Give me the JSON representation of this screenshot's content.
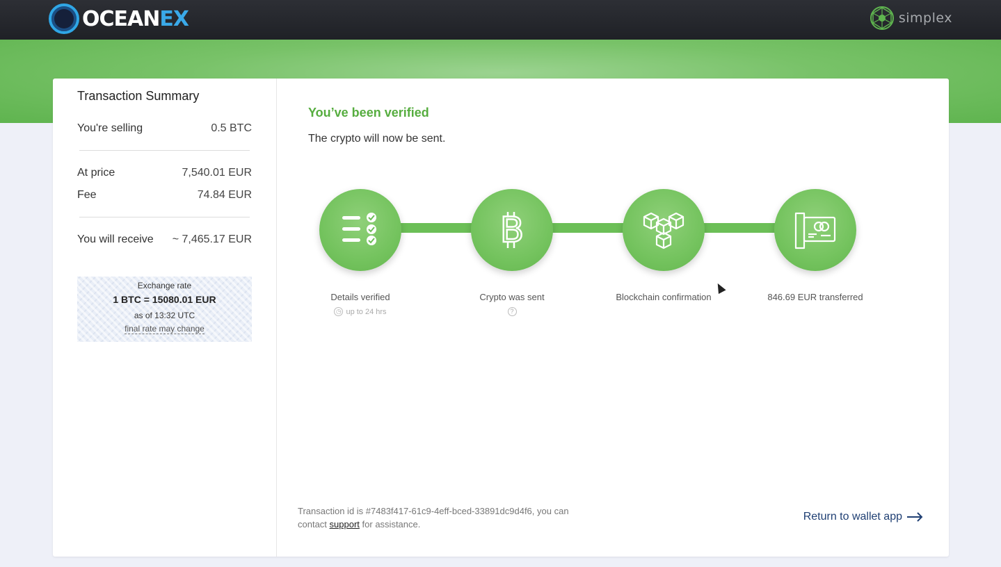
{
  "header": {
    "logo_main": "OCEAN",
    "logo_accent": "EX",
    "partner_name": "simplex",
    "logo_icon": "oceanex-ring-icon",
    "partner_icon": "simplex-network-icon"
  },
  "summary": {
    "title": "Transaction Summary",
    "selling_label": "You're selling",
    "selling_value": "0.5 BTC",
    "price_label": "At price",
    "price_value": "7,540.01 EUR",
    "fee_label": "Fee",
    "fee_value": "74.84 EUR",
    "receive_label": "You will receive",
    "receive_value": "~ 7,465.17 EUR",
    "rate": {
      "label": "Exchange rate",
      "value": "1 BTC = 15080.01 EUR",
      "time": "as of 13:32 UTC",
      "note": "final rate may change"
    }
  },
  "main": {
    "title": "You’ve been verified",
    "subtitle": "The crypto will now be sent.",
    "steps": [
      {
        "label": "Details verified",
        "meta": "up to 24 hrs",
        "icon": "checklist-icon"
      },
      {
        "label": "Crypto was sent",
        "meta": "?",
        "icon": "bitcoin-icon"
      },
      {
        "label": "Blockchain confirmation",
        "meta": "",
        "icon": "blocks-icon"
      },
      {
        "label": "846.69 EUR transferred",
        "meta": "",
        "icon": "card-icon"
      }
    ],
    "footer_prefix": "Transaction id is #7483f417-61c9-4eff-bced-33891dc9d4f6, you can contact",
    "footer_link": "support",
    "footer_suffix": "for assistance.",
    "return_label": "Return to wallet app"
  },
  "colors": {
    "accent_green": "#56ad3f",
    "link_blue": "#1f3f73",
    "brand_blue": "#3aa9e8"
  }
}
